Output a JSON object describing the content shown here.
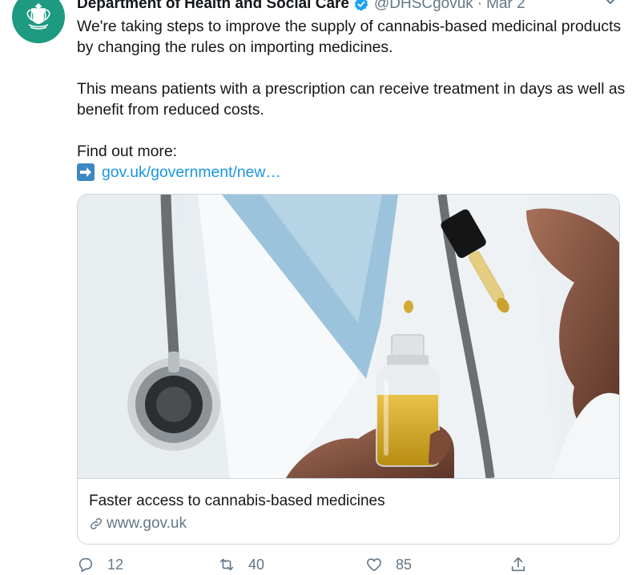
{
  "tweet": {
    "author": {
      "display_name": "Department of Health and Social Care",
      "handle": "@DHSCgovuk",
      "verified": true,
      "avatar_icon": "royal-coat-of-arms-icon",
      "avatar_color": "#1d9a80"
    },
    "separator": "·",
    "date": "Mar 2",
    "text": {
      "paragraph_1": "We're taking steps to improve the supply of cannabis-based medicinal products by changing the rules on importing medicines.",
      "paragraph_2": "This means patients with a prescription can receive treatment in days as well as benefit from reduced costs.",
      "find_out_more": "Find out more:",
      "link_emoji": "arrow-right-emoji",
      "link_text": "gov.uk/government/new…"
    },
    "card": {
      "image_description_icon": "cannabis-oil-dropper-photo",
      "title": "Faster access to cannabis-based medicines",
      "domain": "www.gov.uk"
    },
    "actions": {
      "reply_count": "12",
      "retweet_count": "40",
      "like_count": "85"
    }
  },
  "colors": {
    "link": "#1b95e0",
    "secondary_text": "#657786",
    "verified_badge": "#1da1f2",
    "border": "#ccd6dd"
  }
}
